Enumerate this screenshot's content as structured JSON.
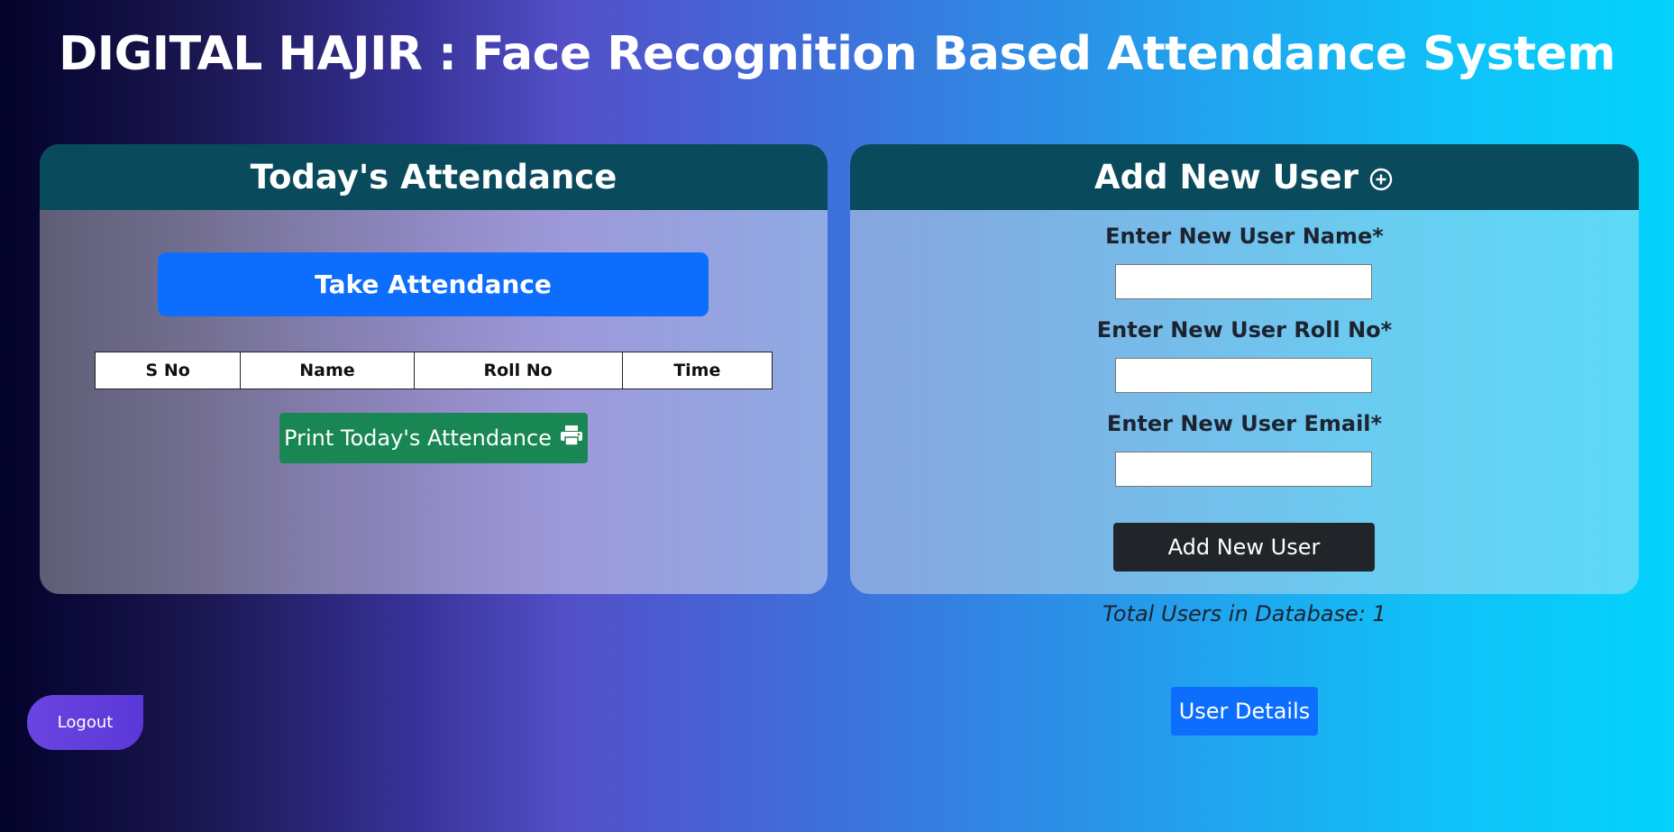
{
  "app": {
    "title": "DIGITAL HAJIR : Face Recognition Based Attendance System"
  },
  "attendance_panel": {
    "title": "Today's Attendance",
    "take_button": "Take Attendance",
    "table": {
      "columns": [
        "S No",
        "Name",
        "Roll No",
        "Time"
      ],
      "rows": []
    },
    "print_button": "Print Today's Attendance",
    "print_icon": "printer-icon"
  },
  "add_user_panel": {
    "title": "Add New User",
    "title_icon": "add-circle-icon",
    "fields": [
      {
        "label": "Enter New User Name*",
        "value": ""
      },
      {
        "label": "Enter New User Roll No*",
        "value": ""
      },
      {
        "label": "Enter New User Email*",
        "value": ""
      }
    ],
    "submit_button": "Add New User"
  },
  "footer": {
    "total_users": "Total Users in Database: 1",
    "user_details_button": "User Details",
    "logout_button": "Logout"
  },
  "colors": {
    "header_bar": "#0a4a5d",
    "primary_button": "#0d6efd",
    "print_button": "#198754",
    "dark_button": "#212529",
    "logout_button": "#6b44e0"
  }
}
